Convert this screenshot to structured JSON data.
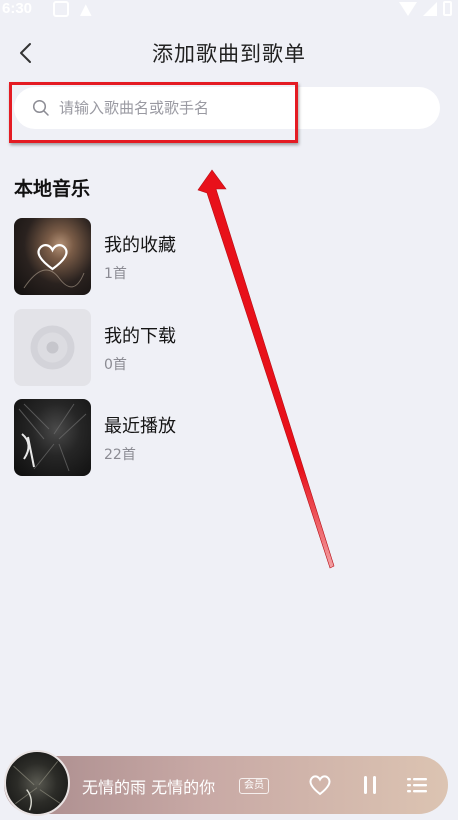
{
  "status_bar": {
    "time": "6:30",
    "icons": [
      "notification-icon",
      "warning-icon",
      "wifi-icon",
      "signal-icon",
      "battery-icon"
    ]
  },
  "header": {
    "title": "添加歌曲到歌单",
    "back_icon": "chevron-left-icon"
  },
  "search": {
    "placeholder": "请输入歌曲名或歌手名",
    "value": ""
  },
  "section": {
    "title": "本地音乐"
  },
  "local_music": [
    {
      "title": "我的收藏",
      "count": "1首"
    },
    {
      "title": "我的下载",
      "count": "0首"
    },
    {
      "title": "最近播放",
      "count": "22首"
    }
  ],
  "player": {
    "song": "无情的雨 无情的你",
    "badge": "会员"
  },
  "colors": {
    "background": "#eff0f6",
    "highlight": "#e41b23",
    "player_gradient_start": "#a88a8c",
    "player_gradient_end": "#dcc4b2"
  }
}
